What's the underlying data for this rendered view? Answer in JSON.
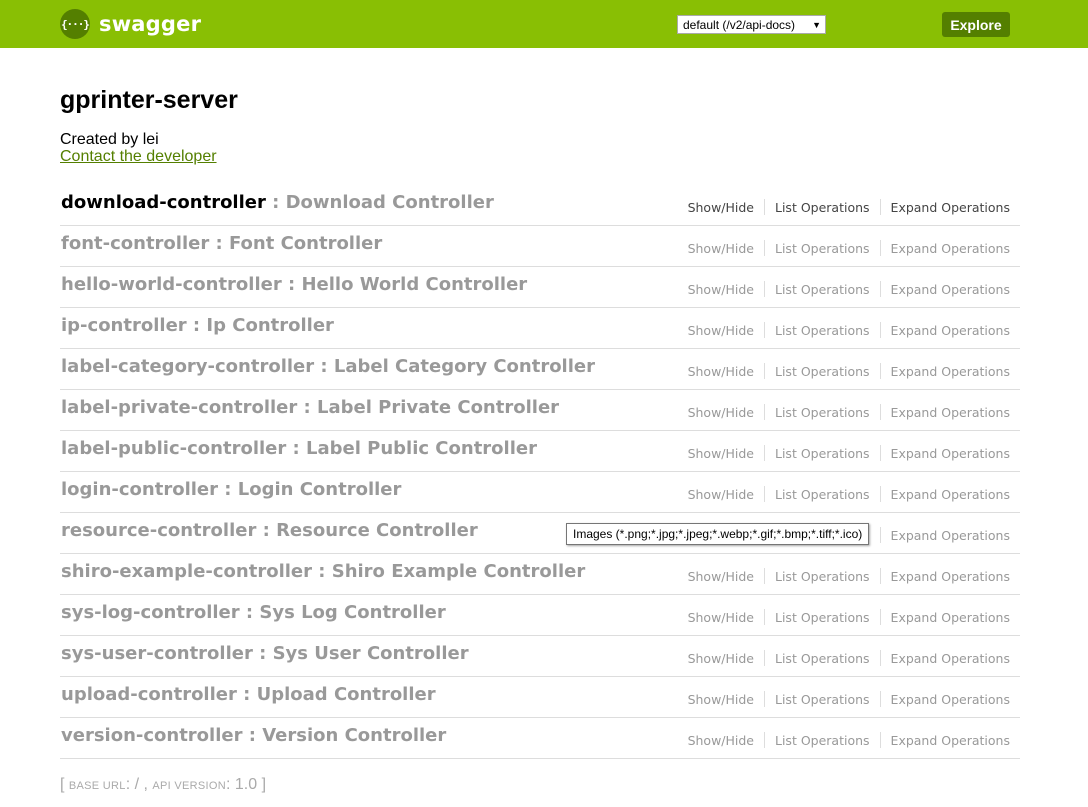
{
  "header": {
    "logo_glyph": "{···}",
    "logo_text": "swagger",
    "spec_select": {
      "selected": "default (/v2/api-docs)"
    },
    "explore_label": "Explore",
    "brand_color": "#89bf04",
    "accent_color": "#547f00"
  },
  "info": {
    "title": "gprinter-server",
    "created_by": "Created by lei",
    "contact_link": "Contact the developer"
  },
  "resources": [
    {
      "name": "download-controller",
      "sep": " : ",
      "desc": "Download Controller"
    },
    {
      "name": "font-controller",
      "sep": " : ",
      "desc": "Font Controller"
    },
    {
      "name": "hello-world-controller",
      "sep": " : ",
      "desc": "Hello World Controller"
    },
    {
      "name": "ip-controller",
      "sep": " : ",
      "desc": "Ip Controller"
    },
    {
      "name": "label-category-controller",
      "sep": " : ",
      "desc": "Label Category Controller"
    },
    {
      "name": "label-private-controller",
      "sep": " : ",
      "desc": "Label Private Controller"
    },
    {
      "name": "label-public-controller",
      "sep": " : ",
      "desc": "Label Public Controller"
    },
    {
      "name": "login-controller",
      "sep": " : ",
      "desc": "Login Controller"
    },
    {
      "name": "resource-controller",
      "sep": " : ",
      "desc": "Resource Controller"
    },
    {
      "name": "shiro-example-controller",
      "sep": " : ",
      "desc": "Shiro Example Controller"
    },
    {
      "name": "sys-log-controller",
      "sep": " : ",
      "desc": "Sys Log Controller"
    },
    {
      "name": "sys-user-controller",
      "sep": " : ",
      "desc": "Sys User Controller"
    },
    {
      "name": "upload-controller",
      "sep": " : ",
      "desc": "Upload Controller"
    },
    {
      "name": "version-controller",
      "sep": " : ",
      "desc": "Version Controller"
    }
  ],
  "ops_labels": {
    "show_hide": "Show/Hide",
    "list_operations": "List Operations",
    "expand_operations": "Expand Operations"
  },
  "tooltip": "Images (*.png;*.jpg;*.jpeg;*.webp;*.gif;*.bmp;*.tiff;*.ico)",
  "footer": {
    "open": "[ ",
    "base_url_label": "base url",
    "base_url_value": ": / , ",
    "api_version_label": "api version",
    "api_version_value": ": 1.0",
    "close": " ]"
  }
}
